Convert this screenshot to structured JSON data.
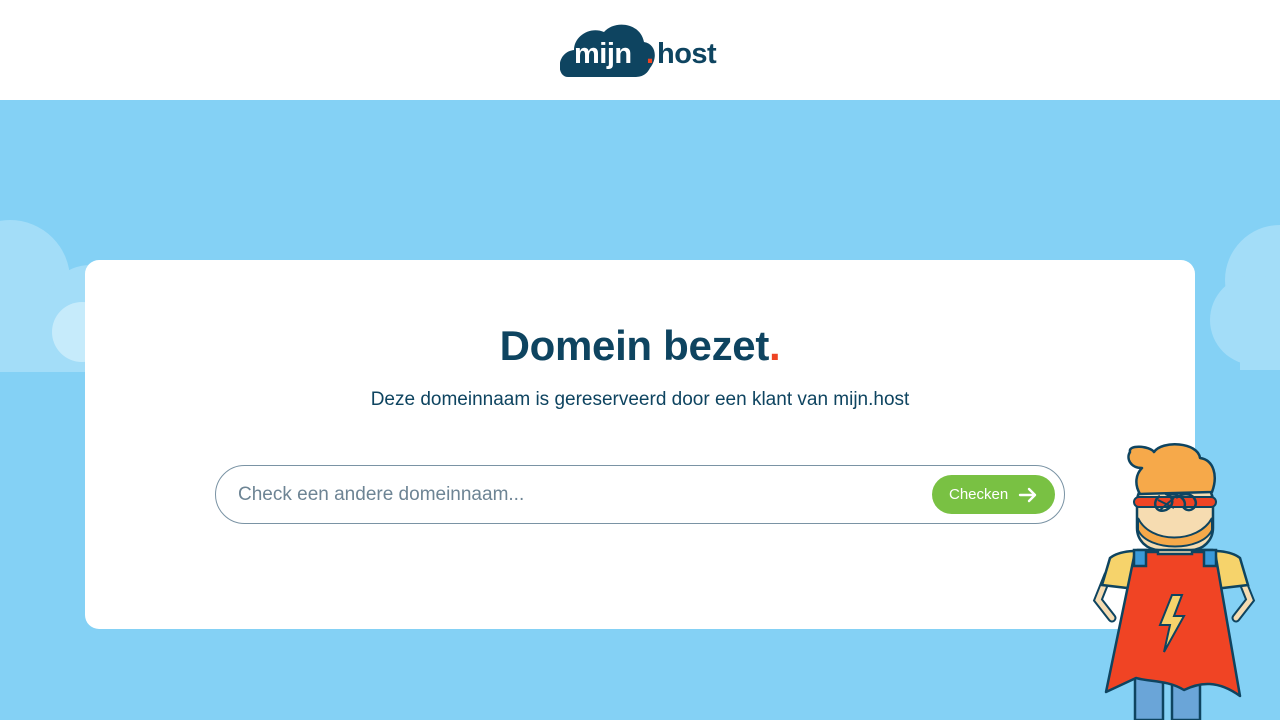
{
  "header": {
    "logo": {
      "part1": "mijn",
      "dot": ".",
      "part2": "host"
    }
  },
  "card": {
    "title": "Domein bezet",
    "title_dot": ".",
    "subtitle": "Deze domeinnaam is gereserveerd door een klant van mijn.host",
    "search": {
      "placeholder": "Check een andere domeinnaam...",
      "value": "",
      "button_label": "Checken",
      "button_icon": "arrow-right-icon"
    }
  },
  "illustration": {
    "name": "superhero-mascot"
  },
  "colors": {
    "sky": "#84d1f5",
    "navy": "#0e4460",
    "accent_red": "#ee4423",
    "button_green": "#79c143"
  }
}
